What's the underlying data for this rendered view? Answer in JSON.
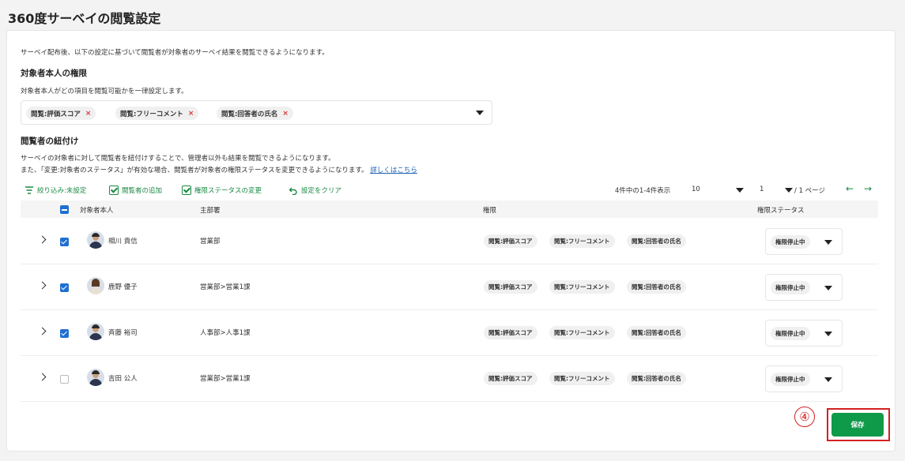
{
  "page": {
    "title": "360度サーベイの閲覧設定",
    "intro": "サーベイ配布後、以下の設定に基づいて閲覧者が対象者のサーベイ結果を閲覧できるようになります。"
  },
  "self_permission": {
    "heading": "対象者本人の権限",
    "description": "対象者本人がどの項目を閲覧可能かを一律設定します。",
    "chips": [
      "閲覧:評価スコア",
      "閲覧:フリーコメント",
      "閲覧:回答者の氏名"
    ],
    "chip_remove": "×"
  },
  "viewer_link": {
    "heading": "閲覧者の紐付け",
    "desc1": "サーベイの対象者に対して閲覧者を紐付けすることで、管理者以外も結果を閲覧できるようになります。",
    "desc2": "また、「変更:対象者のステータス」が有効な場合、閲覧者が対象者の権限ステータスを変更できるようになります。",
    "more_link": "詳しくはこちら"
  },
  "toolbar": {
    "filter": "絞り込み:未設定",
    "add_viewer": "閲覧者の追加",
    "change_status": "権限ステータスの変更",
    "clear": "設定をクリア"
  },
  "pager": {
    "range": "4件中の1-4件表示",
    "per_page": "10",
    "page": "1",
    "total": "/ 1 ページ",
    "prev": "←",
    "next": "→"
  },
  "table": {
    "headers": {
      "name": "対象者本人",
      "dept": "主部署",
      "perm": "権限",
      "status": "権限ステータス"
    },
    "rows": [
      {
        "name": "相川 貴信",
        "dept": "営業部",
        "checked": true,
        "avatar": "male",
        "perms": [
          "閲覧:評価スコア",
          "閲覧:フリーコメント",
          "閲覧:回答者の氏名"
        ],
        "status": "権限停止中"
      },
      {
        "name": "鹿野 優子",
        "dept": "営業部>営業1課",
        "checked": true,
        "avatar": "female",
        "perms": [
          "閲覧:評価スコア",
          "閲覧:フリーコメント",
          "閲覧:回答者の氏名"
        ],
        "status": "権限停止中"
      },
      {
        "name": "斉藤 裕司",
        "dept": "人事部>人事1課",
        "checked": true,
        "avatar": "male",
        "perms": [
          "閲覧:評価スコア",
          "閲覧:フリーコメント",
          "閲覧:回答者の氏名"
        ],
        "status": "権限停止中"
      },
      {
        "name": "吉田 公人",
        "dept": "営業部>営業1課",
        "checked": false,
        "avatar": "male",
        "perms": [
          "閲覧:評価スコア",
          "閲覧:フリーコメント",
          "閲覧:回答者の氏名"
        ],
        "status": "権限停止中"
      }
    ]
  },
  "annotation": "④",
  "save_label": "保存",
  "colors": {
    "accent": "#0f9a4a",
    "checkbox": "#1f6fd1",
    "annotation": "#d32020"
  }
}
